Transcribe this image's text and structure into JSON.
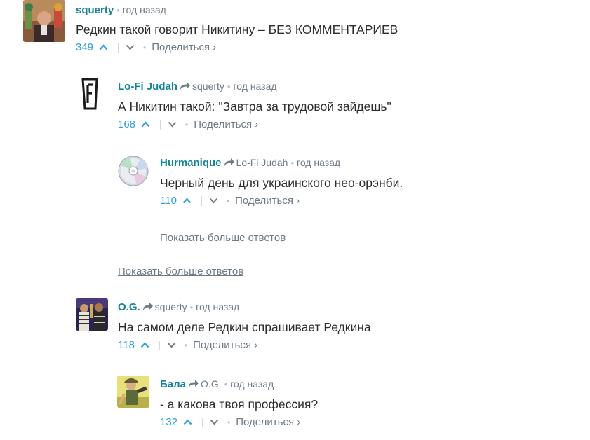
{
  "comments": [
    {
      "author": "squerty",
      "parent": "",
      "time": "год назад",
      "text": "Редкин такой говорит Никитину – БЕЗ КОММЕНТАРИЕВ",
      "votes": "349",
      "share": "Поделиться ›"
    },
    {
      "author": "Lo-Fi Judah",
      "parent": "squerty",
      "time": "год назад",
      "text": "А Никитин такой: \"Завтра за трудовой зайдешь\"",
      "votes": "168",
      "share": "Поделиться ›"
    },
    {
      "author": "Hurmanique",
      "parent": "Lo-Fi Judah",
      "time": "год назад",
      "text": "Черный день для украинского нео-орэнби.",
      "votes": "110",
      "share": "Поделиться ›"
    },
    {
      "author": "O.G.",
      "parent": "squerty",
      "time": "год назад",
      "text": "На самом деле Редкин спрашивает Редкина",
      "votes": "118",
      "share": "Поделиться ›"
    },
    {
      "author": "Бала",
      "parent": "O.G.",
      "time": "год назад",
      "text": "- а какова твоя профессия?",
      "votes": "132",
      "share": "Поделиться ›"
    }
  ],
  "more_replies": [
    "Показать больше ответов",
    "Показать больше ответов"
  ],
  "colors": {
    "author": "#15849a",
    "votes": "#2e9fe0",
    "muted": "#6e7b86"
  }
}
